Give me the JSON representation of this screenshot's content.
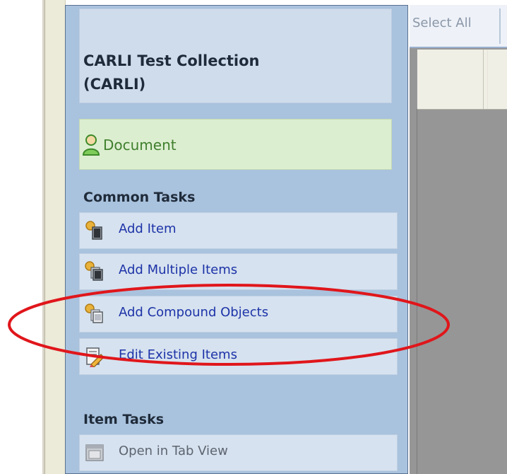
{
  "panel": {
    "collection_title": "CARLI Test Collection\n(CARLI)",
    "document_label": "Document",
    "common_tasks_heading": "Common Tasks",
    "item_tasks_heading": "Item Tasks",
    "common_tasks": [
      {
        "label": "Add Item",
        "icon": "add-item-icon"
      },
      {
        "label": "Add Multiple Items",
        "icon": "add-multiple-items-icon"
      },
      {
        "label": "Add Compound Objects",
        "icon": "add-compound-objects-icon"
      },
      {
        "label": "Edit Existing Items",
        "icon": "edit-existing-items-icon"
      }
    ],
    "item_tasks": [
      {
        "label": "Open in Tab View",
        "icon": "tab-view-icon",
        "disabled": true
      }
    ]
  },
  "toolbar": {
    "select_all_label": "Select All"
  },
  "annotation": {
    "color": "#e0161b"
  }
}
